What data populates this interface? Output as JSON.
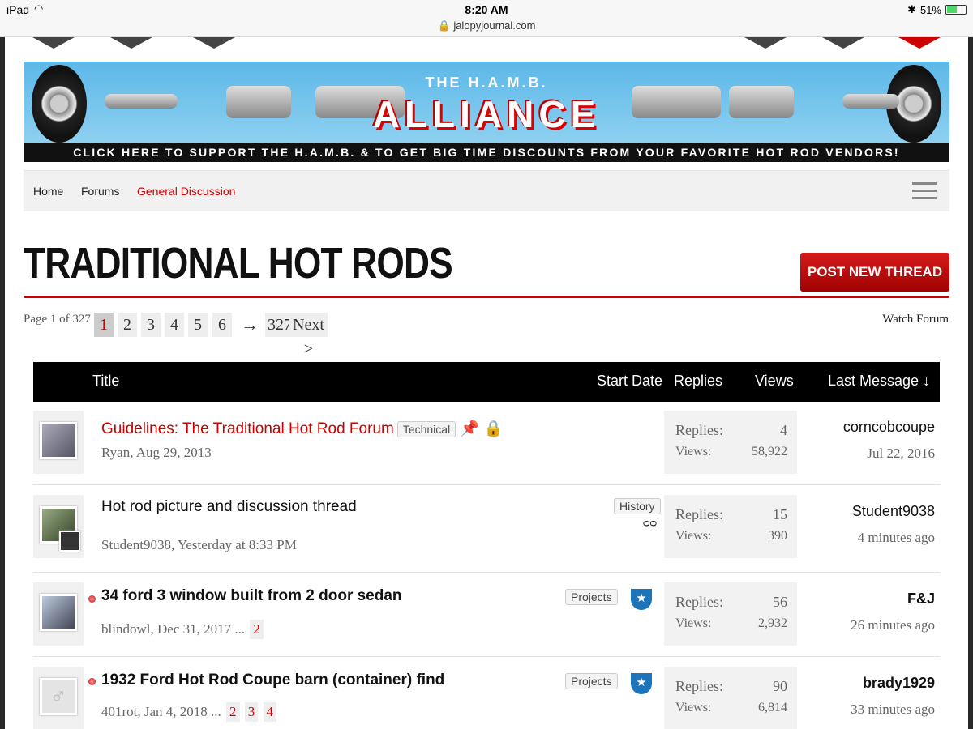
{
  "status": {
    "device": "iPad",
    "time": "8:20 AM",
    "url": "jalopyjournal.com",
    "battery": "51%"
  },
  "banner": {
    "subtitle": "THE H.A.M.B.",
    "headline": "ALLIANCE",
    "strip": "CLICK HERE TO SUPPORT THE H.A.M.B. & TO GET BIG TIME DISCOUNTS FROM YOUR FAVORITE HOT ROD VENDORS!"
  },
  "breadcrumb": {
    "home": "Home",
    "forums": "Forums",
    "current": "General Discussion"
  },
  "page": {
    "title": "TRADITIONAL HOT RODS",
    "post_button": "POST NEW THREAD",
    "watch": "Watch Forum"
  },
  "pager": {
    "label": "Page 1 of 327",
    "pages": [
      "1",
      "2",
      "3",
      "4",
      "5",
      "6"
    ],
    "arrow": "→",
    "last": "327",
    "next": "Next >"
  },
  "table": {
    "title": "Title",
    "start_date": "Start Date",
    "replies": "Replies",
    "views": "Views",
    "last_message": "Last Message ↓"
  },
  "threads": [
    {
      "title": "Guidelines: The Traditional Hot Rod Forum",
      "tag": "Technical",
      "meta": "Ryan, Aug 29, 2013",
      "replies_label": "Replies:",
      "replies": "4",
      "views_label": "Views:",
      "views": "58,922",
      "last_user": "corncobcoupe",
      "last_time": "Jul 22, 2016"
    },
    {
      "title": "Hot rod picture and discussion thread",
      "tag": "History",
      "meta": "Student9038, Yesterday at 8:33 PM",
      "replies_label": "Replies:",
      "replies": "15",
      "views_label": "Views:",
      "views": "390",
      "last_user": "Student9038",
      "last_time": "4 minutes ago"
    },
    {
      "title": "34 ford 3 window built from 2 door sedan",
      "tag": "Projects",
      "meta": "blindowl, Dec 31, 2017  ...",
      "pages": [
        "2"
      ],
      "replies_label": "Replies:",
      "replies": "56",
      "views_label": "Views:",
      "views": "2,932",
      "last_user": "F&J",
      "last_time": "26 minutes ago"
    },
    {
      "title": "1932 Ford Hot Rod Coupe barn (container) find",
      "tag": "Projects",
      "meta": "401rot, Jan 4, 2018  ...",
      "pages": [
        "2",
        "3",
        "4"
      ],
      "replies_label": "Replies:",
      "replies": "90",
      "views_label": "Views:",
      "views": "6,814",
      "last_user": "brady1929",
      "last_time": "33 minutes ago"
    }
  ],
  "icons": {
    "pin": "pushpin-icon",
    "lock": "lock-icon",
    "watch": "glasses-icon",
    "shield": "shield-star-icon"
  }
}
